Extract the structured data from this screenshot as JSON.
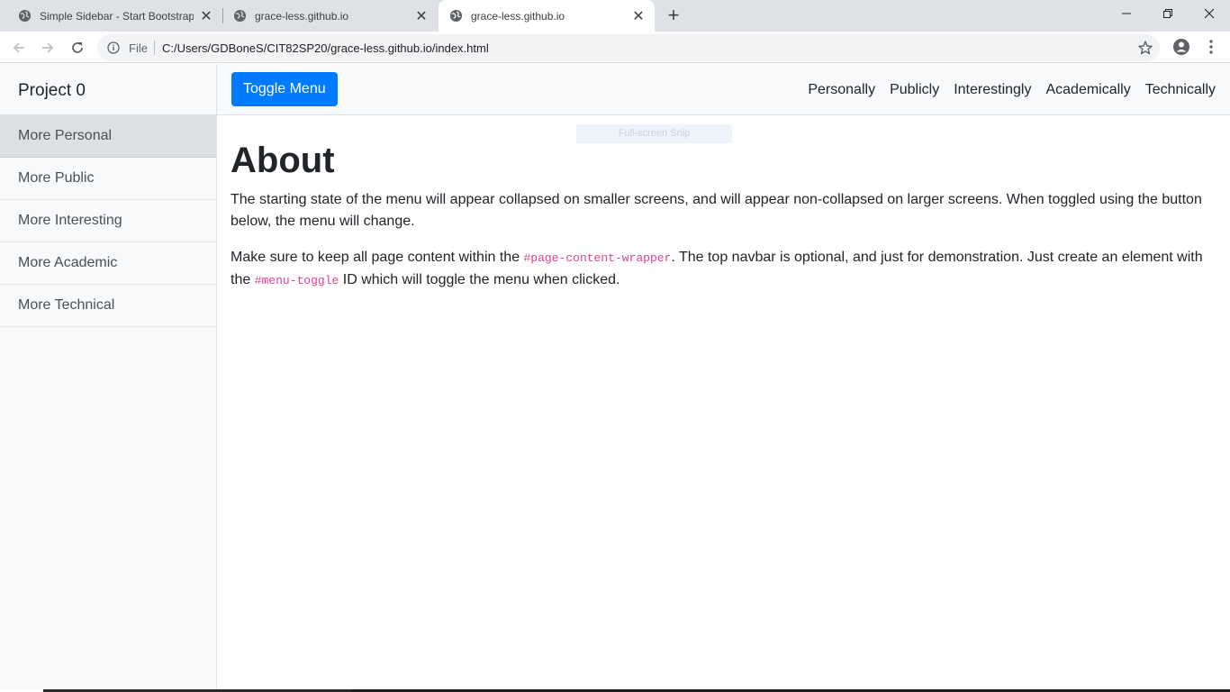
{
  "browser": {
    "tabs": [
      {
        "title": "Simple Sidebar - Start Bootstrap",
        "active": false
      },
      {
        "title": "grace-less.github.io",
        "active": false
      },
      {
        "title": "grace-less.github.io",
        "active": true
      }
    ],
    "omnibox": {
      "scheme_label": "File",
      "url": "C:/Users/GDBoneS/CIT82SP20/grace-less.github.io/index.html"
    }
  },
  "sidebar": {
    "heading": "Project 0",
    "items": [
      {
        "label": "More Personal",
        "active": true
      },
      {
        "label": "More Public"
      },
      {
        "label": "More Interesting"
      },
      {
        "label": "More Academic"
      },
      {
        "label": "More Technical"
      }
    ]
  },
  "topnav": {
    "toggle_label": "Toggle Menu",
    "links": [
      "Personally",
      "Publicly",
      "Interestingly",
      "Academically",
      "Technically"
    ]
  },
  "overlay": {
    "snip_label": "Full-screen Snip"
  },
  "main": {
    "title": "About",
    "para1": "The starting state of the menu will appear collapsed on smaller screens, and will appear non-collapsed on larger screens. When toggled using the button below, the menu will change.",
    "para2_a": "Make sure to keep all page content within the ",
    "para2_code1": "#page-content-wrapper",
    "para2_b": ". The top navbar is optional, and just for demonstration. Just create an element with the ",
    "para2_code2": "#menu-toggle",
    "para2_c": " ID which will toggle the menu when clicked."
  },
  "colors": {
    "accent": "#007bff",
    "code": "#e83e8c",
    "sidebar_bg": "#f8f9fa",
    "sidebar_active": "#dde0e3"
  },
  "icons": [
    "globe-icon",
    "close-icon",
    "plus-icon",
    "minimize-icon",
    "restore-icon",
    "window-close-icon",
    "back-icon",
    "forward-icon",
    "reload-icon",
    "info-icon",
    "star-icon",
    "account-icon",
    "menu-dots-icon"
  ]
}
